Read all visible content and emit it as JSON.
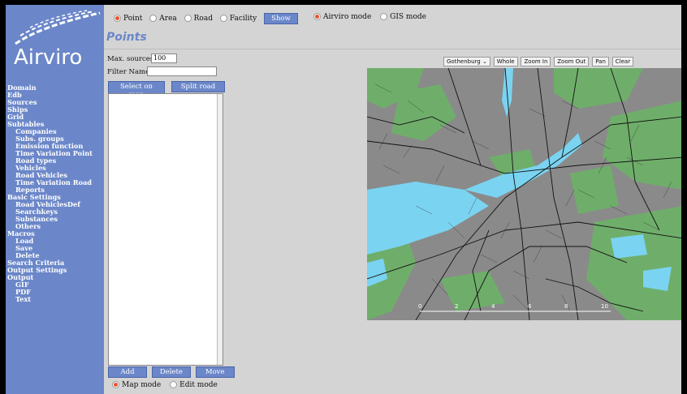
{
  "logo": {
    "text": "Airviro"
  },
  "sidebar": {
    "items": [
      {
        "label": "Domain",
        "sub": false
      },
      {
        "label": "Edb",
        "sub": false
      },
      {
        "label": "Sources",
        "sub": false
      },
      {
        "label": "Ships",
        "sub": false
      },
      {
        "label": "Grid",
        "sub": false
      },
      {
        "label": "Subtables",
        "sub": false
      },
      {
        "label": "Companies",
        "sub": true
      },
      {
        "label": "Subs. groups",
        "sub": true
      },
      {
        "label": "Emission function",
        "sub": true
      },
      {
        "label": "Time Variation Point",
        "sub": true
      },
      {
        "label": "Road types",
        "sub": true
      },
      {
        "label": "Vehicles",
        "sub": true
      },
      {
        "label": "Road Vehicles",
        "sub": true
      },
      {
        "label": "Time Variation Road",
        "sub": true
      },
      {
        "label": "Reports",
        "sub": true
      },
      {
        "label": "Basic Settings",
        "sub": false
      },
      {
        "label": "Road VehiclesDef",
        "sub": true
      },
      {
        "label": "Searchkeys",
        "sub": true
      },
      {
        "label": "Substances",
        "sub": true
      },
      {
        "label": "Others",
        "sub": true
      },
      {
        "label": "Macros",
        "sub": false
      },
      {
        "label": "Load",
        "sub": true
      },
      {
        "label": "Save",
        "sub": true
      },
      {
        "label": "Delete",
        "sub": true
      },
      {
        "label": "Search Criteria",
        "sub": false
      },
      {
        "label": "Output Settings",
        "sub": false
      },
      {
        "label": "Output",
        "sub": false
      },
      {
        "label": "GIF",
        "sub": true
      },
      {
        "label": "PDF",
        "sub": true
      },
      {
        "label": "Text",
        "sub": true
      }
    ]
  },
  "source_type": {
    "options": [
      "Point",
      "Area",
      "Road",
      "Facility"
    ],
    "selected": "Point",
    "show_label": "Show"
  },
  "mode": {
    "options": [
      "Airviro mode",
      "GIS mode"
    ],
    "selected": "Airviro mode"
  },
  "page_title": "Points",
  "form": {
    "max_sources_label": "Max. sources:",
    "max_sources_value": "100",
    "filter_label": "Filter Name:",
    "filter_value": "",
    "select_on_map": "Select on map",
    "split_road": "Split road"
  },
  "map_toolbar": {
    "area_select": "Gothenburg",
    "buttons": [
      "Whole",
      "Zoom In",
      "Zoom Out",
      "Pan",
      "Clear"
    ]
  },
  "map": {
    "scale_labels": [
      "0",
      "2",
      "4",
      "6",
      "8",
      "10"
    ],
    "colors": {
      "land": "#8a8a8a",
      "water": "#7ad3f0",
      "forest": "#6fae6a",
      "road": "#111111"
    }
  },
  "list_actions": [
    "Add",
    "Delete",
    "Move"
  ],
  "edit_mode": {
    "options": [
      "Map mode",
      "Edit mode"
    ],
    "selected": "Map mode"
  }
}
